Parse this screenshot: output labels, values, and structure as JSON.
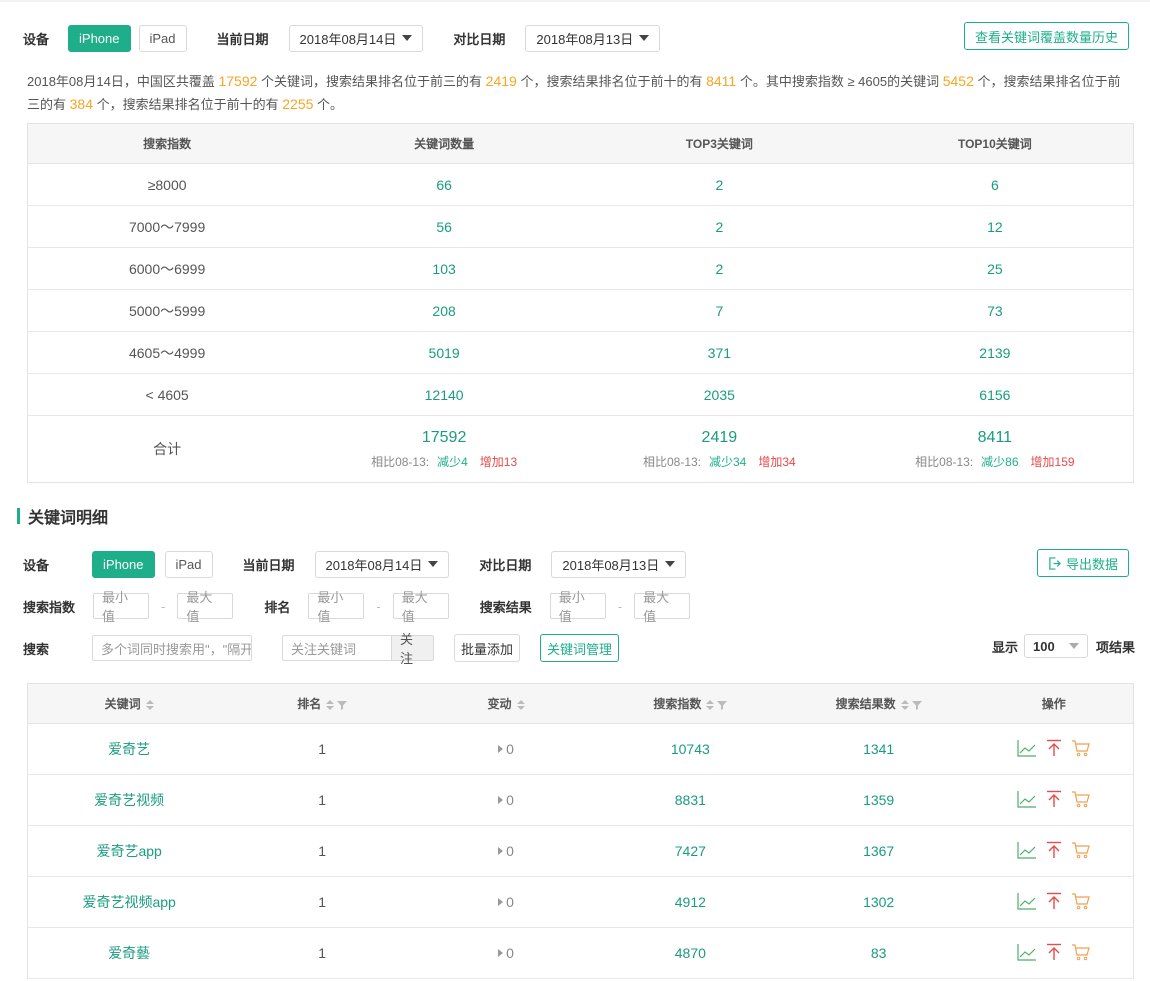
{
  "filters1": {
    "device_label": "设备",
    "device_options": [
      "iPhone",
      "iPad"
    ],
    "current_date_label": "当前日期",
    "current_date": "2018年08月14日",
    "compare_date_label": "对比日期",
    "compare_date": "2018年08月13日",
    "history_button": "查看关键词覆盖数量历史"
  },
  "summary": {
    "p1": "2018年08月14日，中国区共覆盖",
    "v1": "17592",
    "p2": "个关键词，搜索结果排名位于前三的有",
    "v2": "2419",
    "p3": "个，搜索结果排名位于前十的有",
    "v3": "8411",
    "p4": "个。其中搜索指数 ≥ 4605的关键词",
    "v4": "5452",
    "p5": "个，搜索结果排名位于前三的有",
    "v5": "384",
    "p6": "个，搜索结果排名位于前十的有",
    "v6": "2255",
    "p7": "个。"
  },
  "coverage_table": {
    "headers": [
      "搜索指数",
      "关键词数量",
      "TOP3关键词",
      "TOP10关键词"
    ],
    "rows": [
      [
        "≥8000",
        "66",
        "2",
        "6"
      ],
      [
        "7000～7999",
        "56",
        "2",
        "12"
      ],
      [
        "6000～6999",
        "103",
        "2",
        "25"
      ],
      [
        "5000～5999",
        "208",
        "7",
        "73"
      ],
      [
        "4605～4999",
        "5019",
        "371",
        "2139"
      ],
      [
        "< 4605",
        "12140",
        "2035",
        "6156"
      ]
    ],
    "total": {
      "label": "合计",
      "cells": [
        {
          "value": "17592",
          "cmp": "相比08-13:",
          "down": "减少4",
          "up": "增加13"
        },
        {
          "value": "2419",
          "cmp": "相比08-13:",
          "down": "减少34",
          "up": "增加34"
        },
        {
          "value": "8411",
          "cmp": "相比08-13:",
          "down": "减少86",
          "up": "增加159"
        }
      ]
    }
  },
  "section_title": "关键词明细",
  "filters2": {
    "device_label": "设备",
    "device_options": [
      "iPhone",
      "iPad"
    ],
    "current_date_label": "当前日期",
    "current_date": "2018年08月14日",
    "compare_date_label": "对比日期",
    "compare_date": "2018年08月13日",
    "export_button": "导出数据",
    "search_index_label": "搜索指数",
    "rank_label": "排名",
    "result_label": "搜索结果",
    "min_placeholder": "最小值",
    "max_placeholder": "最大值",
    "search_label": "搜索",
    "search_placeholder": "多个词同时搜索用\"，\"隔开",
    "follow_placeholder": "关注关键词",
    "follow_button": "关注",
    "batch_add_button": "批量添加",
    "manage_button": "关键词管理",
    "show_label": "显示",
    "page_size": "100",
    "result_suffix": "项结果"
  },
  "keyword_table": {
    "headers": [
      "关键词",
      "排名",
      "变动",
      "搜索指数",
      "搜索结果数",
      "操作"
    ],
    "rows": [
      {
        "keyword": "爱奇艺",
        "rank": "1",
        "change": "0",
        "index": "10743",
        "results": "1341"
      },
      {
        "keyword": "爱奇艺视频",
        "rank": "1",
        "change": "0",
        "index": "8831",
        "results": "1359"
      },
      {
        "keyword": "爱奇艺app",
        "rank": "1",
        "change": "0",
        "index": "7427",
        "results": "1367"
      },
      {
        "keyword": "爱奇艺视频app",
        "rank": "1",
        "change": "0",
        "index": "4912",
        "results": "1302"
      },
      {
        "keyword": "爱奇藝",
        "rank": "1",
        "change": "0",
        "index": "4870",
        "results": "83"
      }
    ]
  },
  "colors": {
    "accent": "#1eaf8a",
    "highlight": "#f5a623",
    "increase": "#e64a4a"
  }
}
